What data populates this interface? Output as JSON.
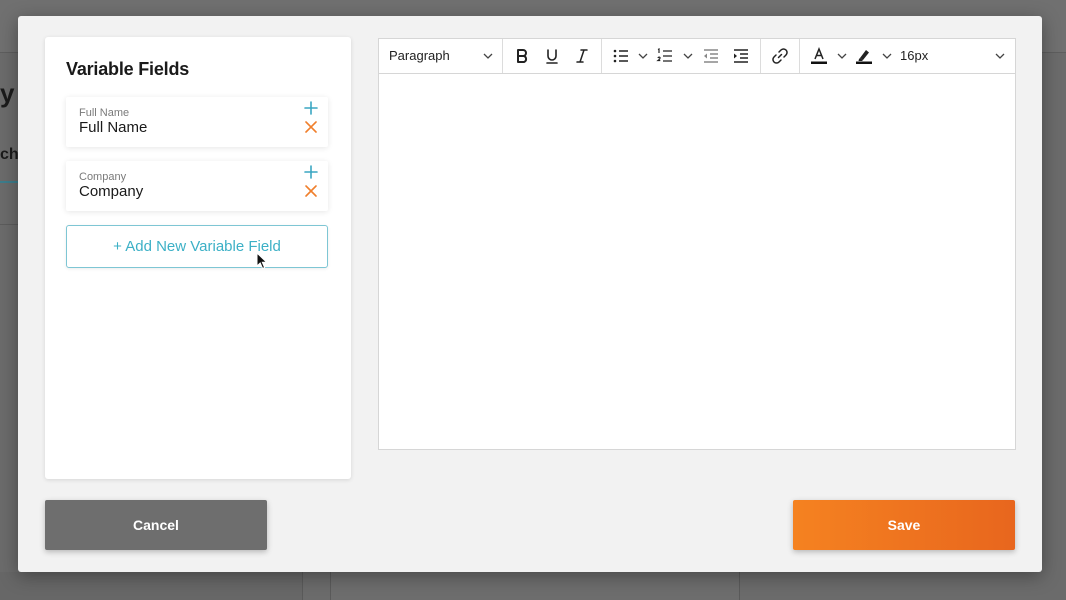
{
  "background": {
    "heading_fragment": "y",
    "tab_fragment": "ch"
  },
  "variable_panel": {
    "title": "Variable Fields",
    "fields": [
      {
        "label": "Full Name",
        "value": "Full Name"
      },
      {
        "label": "Company",
        "value": "Company"
      }
    ],
    "add_button_label": "+ Add New Variable Field",
    "add_icon": "plus-icon",
    "remove_icon": "close-icon"
  },
  "editor": {
    "block_format": "Paragraph",
    "font_size": "16px",
    "tools": [
      "bold-icon",
      "underline-icon",
      "italic-icon",
      "bullet-list-icon",
      "numbered-list-icon",
      "outdent-icon",
      "indent-icon",
      "link-icon",
      "text-color-icon",
      "highlight-icon"
    ]
  },
  "footer": {
    "cancel_label": "Cancel",
    "save_label": "Save"
  },
  "colors": {
    "accent_teal": "#3cb0c6",
    "remove_orange": "#f07f2c",
    "save_orange": "#f58220",
    "cancel_gray": "#6e6e6e"
  }
}
